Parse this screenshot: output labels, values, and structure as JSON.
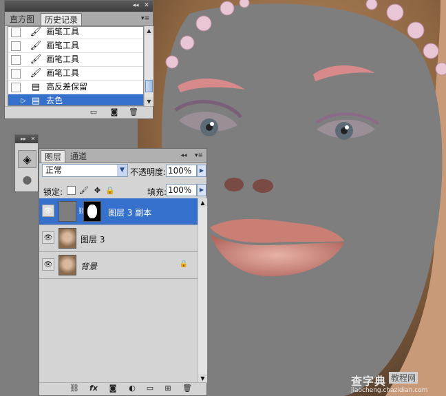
{
  "history_panel": {
    "tabs": [
      "直方图",
      "历史记录"
    ],
    "active_tab": "历史记录",
    "items": [
      {
        "label": "画笔工具",
        "icon": "brush-icon"
      },
      {
        "label": "画笔工具",
        "icon": "brush-icon"
      },
      {
        "label": "画笔工具",
        "icon": "brush-icon"
      },
      {
        "label": "画笔工具",
        "icon": "brush-icon"
      },
      {
        "label": "高反差保留",
        "icon": "filter-doc-icon"
      },
      {
        "label": "去色",
        "icon": "filter-doc-icon",
        "selected": true
      }
    ],
    "bottom_icons": [
      "new-document-icon",
      "snapshot-icon",
      "trash-icon"
    ]
  },
  "layers_panel": {
    "tabs": [
      "图层",
      "通道"
    ],
    "active_tab": "图层",
    "blend_mode": "正常",
    "opacity_label": "不透明度:",
    "opacity_value": "100%",
    "lock_label": "锁定:",
    "fill_label": "填充:",
    "fill_value": "100%",
    "layers": [
      {
        "name": "图层 3 副本",
        "selected": true,
        "has_mask": true
      },
      {
        "name": "图层 3",
        "selected": false
      },
      {
        "name": "背景",
        "selected": false,
        "locked": true
      }
    ],
    "bottom_icons": [
      "link-icon",
      "fx-icon",
      "mask-icon",
      "adjustment-icon",
      "group-icon",
      "new-layer-icon",
      "trash-icon"
    ]
  },
  "watermark": {
    "brand": "查字典",
    "tag": "教程网",
    "url": "jiaocheng.chazidian.com"
  }
}
